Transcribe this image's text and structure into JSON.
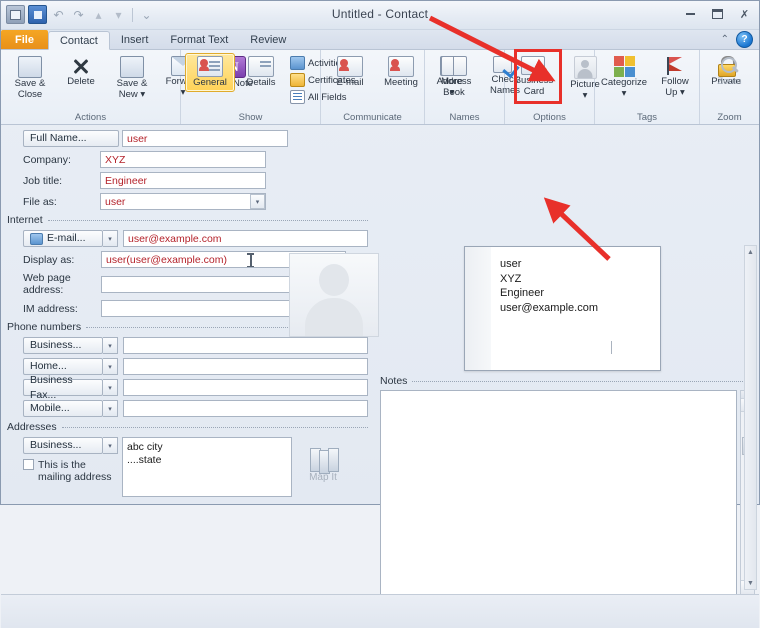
{
  "window": {
    "title": "Untitled - Contact",
    "minimize": "─",
    "restore": "❐",
    "close": "✕"
  },
  "quick_access": {
    "items": [
      {
        "name": "app-menu-icon",
        "glyph": ""
      },
      {
        "name": "save-icon",
        "glyph": ""
      },
      {
        "name": "undo-icon",
        "glyph": "↶"
      },
      {
        "name": "redo-icon",
        "glyph": "↷"
      },
      {
        "name": "previous-item-icon",
        "glyph": "▴"
      },
      {
        "name": "next-item-icon",
        "glyph": "▾"
      },
      {
        "name": "customize-qat-icon",
        "glyph": "☰"
      }
    ]
  },
  "tabs": [
    {
      "label": "File",
      "active": false,
      "type": "file"
    },
    {
      "label": "Contact",
      "active": true,
      "type": "normal"
    },
    {
      "label": "Insert",
      "active": false,
      "type": "normal"
    },
    {
      "label": "Format Text",
      "active": false,
      "type": "normal"
    },
    {
      "label": "Review",
      "active": false,
      "type": "normal"
    }
  ],
  "tabstrip_right": {
    "collapse_ribbon": "⌃",
    "help": "?"
  },
  "ribbon": {
    "groups": [
      {
        "label": "Actions",
        "buttons": [
          {
            "label": "Save &\nClose",
            "icon": "save-and-close-icon",
            "selected": false
          },
          {
            "label": "Delete",
            "icon": "delete-icon",
            "selected": false
          },
          {
            "label": "Save &\nNew ▾",
            "icon": "save-and-new-icon",
            "selected": false
          },
          {
            "label": "Forward\n▾",
            "icon": "forward-icon",
            "selected": false
          },
          {
            "label": "OneNote",
            "icon": "onenote-icon",
            "selected": false
          }
        ]
      },
      {
        "label": "Show",
        "buttons": [
          {
            "label": "General",
            "icon": "general-icon",
            "selected": true
          },
          {
            "label": "Details",
            "icon": "details-icon",
            "selected": false
          }
        ],
        "small_buttons": [
          {
            "label": "Activities",
            "icon": "activities-icon"
          },
          {
            "label": "Certificates",
            "icon": "certificates-icon"
          },
          {
            "label": "All Fields",
            "icon": "all-fields-icon"
          }
        ]
      },
      {
        "label": "Communicate",
        "buttons": [
          {
            "label": "E-mail",
            "icon": "email-icon",
            "selected": false
          },
          {
            "label": "Meeting",
            "icon": "meeting-icon",
            "selected": false
          },
          {
            "label": "More\n▾",
            "icon": "more-icon",
            "selected": false
          }
        ]
      },
      {
        "label": "Names",
        "buttons": [
          {
            "label": "Address\nBook",
            "icon": "address-book-icon",
            "selected": false
          },
          {
            "label": "Check\nNames",
            "icon": "check-names-icon",
            "selected": false
          }
        ]
      },
      {
        "label": "Options",
        "buttons": [
          {
            "label": "Business\nCard",
            "icon": "business-card-icon",
            "selected": false
          },
          {
            "label": "Picture\n▾",
            "icon": "picture-icon",
            "selected": false
          }
        ]
      },
      {
        "label": "Tags",
        "buttons": [
          {
            "label": "Categorize\n▾",
            "icon": "categorize-icon",
            "selected": false
          },
          {
            "label": "Follow\nUp ▾",
            "icon": "follow-up-icon",
            "selected": false
          },
          {
            "label": "Private",
            "icon": "private-icon",
            "selected": false
          }
        ]
      },
      {
        "label": "Zoom",
        "buttons": [
          {
            "label": "Zoom",
            "icon": "zoom-icon",
            "selected": false,
            "dim": true
          }
        ]
      }
    ]
  },
  "form": {
    "full_name": {
      "button": "Full Name...",
      "value": "user"
    },
    "company": {
      "label": "Company:",
      "value": "XYZ"
    },
    "job_title": {
      "label": "Job title:",
      "value": "Engineer"
    },
    "file_as": {
      "label": "File as:",
      "value": "user"
    },
    "internet": {
      "section": "Internet",
      "email": {
        "button": "E-mail...",
        "value": "user@example.com"
      },
      "display_as": {
        "label": "Display as:",
        "value": "user(user@example.com)"
      },
      "web_page": {
        "label": "Web page address:",
        "value": ""
      },
      "im": {
        "label": "IM address:",
        "value": ""
      }
    },
    "phones": {
      "section": "Phone numbers",
      "rows": [
        {
          "button": "Business...",
          "value": ""
        },
        {
          "button": "Home...",
          "value": ""
        },
        {
          "button": "Business Fax...",
          "value": ""
        },
        {
          "button": "Mobile...",
          "value": ""
        }
      ]
    },
    "addresses": {
      "section": "Addresses",
      "type_button": "Business...",
      "mailing_checkbox": "This is the mailing address",
      "mailing_checked": false,
      "value_line1": "abc city",
      "value_line2": "....state",
      "map_it": "Map It"
    }
  },
  "business_card": {
    "lines": [
      "user",
      "XYZ",
      "Engineer",
      "user@example.com"
    ]
  },
  "notes": {
    "label": "Notes",
    "value": ""
  },
  "annotations": {
    "highlight_target": "Business Card",
    "color": "#e8302a"
  },
  "colors": {
    "accent_orange": "#f5a623",
    "selected_gold": "#ffd257",
    "annotation_red": "#e8302a",
    "field_text_red": "#b4232b"
  }
}
